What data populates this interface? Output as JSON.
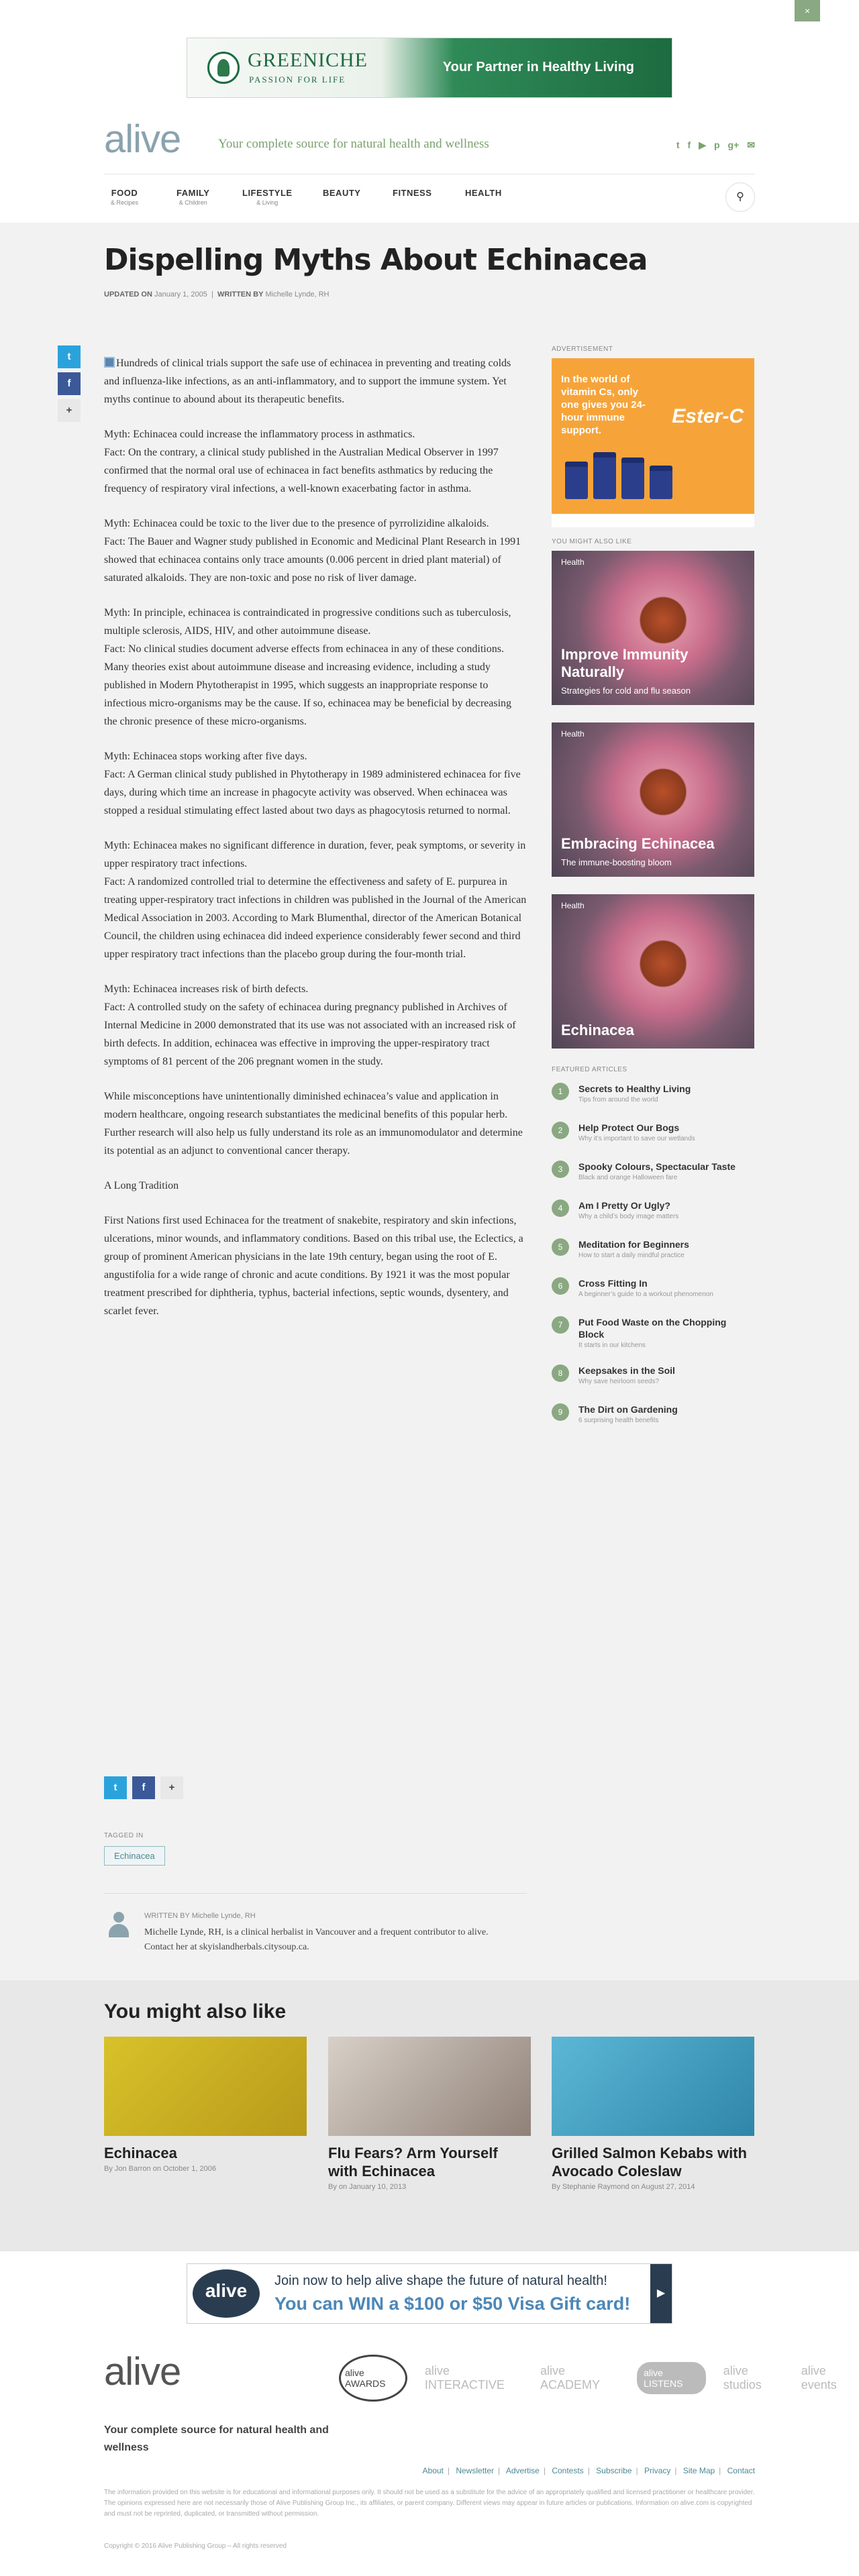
{
  "top": {
    "close_label": "×"
  },
  "banner": {
    "brand": "GREENICHE",
    "tagline": "PASSION FOR LIFE",
    "right_text": "Your Partner in Healthy Living"
  },
  "header": {
    "logo": "alive",
    "tagline": "Your complete source for natural health and wellness",
    "socials": [
      "t",
      "f",
      "▶",
      "p",
      "g+",
      "✉"
    ]
  },
  "nav": [
    {
      "label": "FOOD",
      "sub": "& Recipes"
    },
    {
      "label": "FAMILY",
      "sub": "& Children"
    },
    {
      "label": "LIFESTYLE",
      "sub": "& Living"
    },
    {
      "label": "BEAUTY",
      "sub": ""
    },
    {
      "label": "FITNESS",
      "sub": ""
    },
    {
      "label": "HEALTH",
      "sub": ""
    }
  ],
  "article": {
    "title": "Dispelling Myths About Echinacea",
    "updated_label": "UPDATED ON",
    "updated_date": "January 1, 2005",
    "written_label": "WRITTEN BY",
    "author": "Michelle Lynde, RH",
    "paragraphs": [
      "Hundreds of clinical trials support the safe use of echinacea in preventing and treating colds and influenza-like infections, as an anti-inflammatory, and to support the immune system. Yet myths continue to abound about its therapeutic benefits.",
      "Myth: Echinacea could increase the inflammatory process in asthmatics.\nFact: On the contrary, a clinical study published in the Australian Medical Observer in 1997 confirmed that the normal oral use of echinacea in fact benefits asthmatics by reducing the frequency of respiratory viral infections, a well-known exacerbating factor in asthma.",
      "Myth: Echinacea could be toxic to the liver due to the presence of pyrrolizidine alkaloids.\nFact: The Bauer and Wagner study published in Economic and Medicinal Plant Research in 1991 showed that echinacea contains only trace amounts (0.006 percent in dried plant material) of saturated alkaloids. They are non-toxic and pose no risk of liver damage.",
      "Myth: In principle, echinacea is contraindicated in progressive conditions such as tuberculosis, multiple sclerosis, AIDS, HIV, and other autoimmune disease.\nFact: No clinical studies document adverse effects from echinacea in any of these conditions. Many theories exist about autoimmune disease and increasing evidence, including a study published in Modern Phytotherapist in 1995, which suggests an inappropriate response to infectious micro-organisms may be the cause. If so, echinacea may be beneficial by decreasing the chronic presence of these micro-organisms.",
      "Myth: Echinacea stops working after five days.\nFact: A German clinical study published in Phytotherapy in 1989 administered echinacea for five days, during which time an increase in phagocyte activity was observed. When echinacea was stopped a residual stimulating effect lasted about two days as phagocytosis returned to normal.",
      "Myth: Echinacea makes no significant difference in duration, fever, peak symptoms, or severity in upper respiratory tract infections.\nFact: A randomized controlled trial to determine the effectiveness and safety of E. purpurea in treating upper-respiratory tract infections in children was published in the Journal of the American Medical Association in 2003. According to Mark Blumenthal, director of the American Botanical Council, the children using echinacea did indeed experience considerably fewer second and third upper respiratory tract infections than the placebo group during the four-month trial.",
      "Myth: Echinacea increases risk of birth defects.\nFact: A controlled study on the safety of echinacea during pregnancy published in Archives of Internal Medicine in 2000 demonstrated that its use was not associated with an increased risk of birth defects. In addition, echinacea was effective in improving the upper-respiratory tract symptoms of 81 percent of the 206 pregnant women in the study.",
      "While misconceptions have unintentionally diminished echinacea’s value and application in modern healthcare, ongoing research substantiates the medicinal benefits of this popular herb. Further research will also help us fully understand its role as an immunomodulator and determine its potential as an adjunct to conventional cancer therapy.",
      "A Long Tradition",
      "First Nations first used Echinacea for the treatment of snakebite, respiratory and skin infections, ulcerations, minor wounds, and inflammatory conditions. Based on this tribal use, the Eclectics, a group of prominent American physicians in the late 19th century, began using the root of E. angustifolia for a wide range of chronic and acute conditions. By 1921 it was the most popular treatment prescribed for diphtheria, typhus, bacterial infections, septic wounds, dysentery, and scarlet fever."
    ],
    "tagged_label": "TAGGED IN",
    "tag": "Echinacea",
    "author_box_label": "WRITTEN BY",
    "author_bio": "Michelle Lynde, RH, is a clinical herbalist in Vancouver and a frequent contributor to alive. Contact her at skyislandherbals.citysoup.ca."
  },
  "share": {
    "twitter": "t",
    "facebook": "f",
    "more": "+"
  },
  "sidebar": {
    "ad_label": "ADVERTISEMENT",
    "ad_text": "In the world of vitamin Cs, only one gives you 24-hour immune support.",
    "ad_brand": "Ester-C",
    "might_label": "YOU MIGHT ALSO LIKE",
    "cards": [
      {
        "category": "Health",
        "title": "Improve Immunity Naturally",
        "sub": "Strategies for cold and flu season"
      },
      {
        "category": "Health",
        "title": "Embracing Echinacea",
        "sub": "The immune-boosting bloom"
      },
      {
        "category": "Health",
        "title": "Echinacea",
        "sub": ""
      }
    ],
    "featured_label": "FEATURED ARTICLES",
    "featured": [
      {
        "n": "1",
        "title": "Secrets to Healthy Living",
        "sub": "Tips from around the world"
      },
      {
        "n": "2",
        "title": "Help Protect Our Bogs",
        "sub": "Why it’s important to save our wetlands"
      },
      {
        "n": "3",
        "title": "Spooky Colours, Spectacular Taste",
        "sub": "Black and orange Halloween fare"
      },
      {
        "n": "4",
        "title": "Am I Pretty Or Ugly?",
        "sub": "Why a child’s body image matters"
      },
      {
        "n": "5",
        "title": "Meditation for Beginners",
        "sub": "How to start a daily mindful practice"
      },
      {
        "n": "6",
        "title": "Cross Fitting In",
        "sub": "A beginner’s guide to a workout phenomenon"
      },
      {
        "n": "7",
        "title": "Put Food Waste on the Chopping Block",
        "sub": "It starts in our kitchens"
      },
      {
        "n": "8",
        "title": "Keepsakes in the Soil",
        "sub": "Why save heirloom seeds?"
      },
      {
        "n": "9",
        "title": "The Dirt on Gardening",
        "sub": "6 surprising health benefits"
      }
    ]
  },
  "more": {
    "heading": "You might also like",
    "cards": [
      {
        "title": "Echinacea",
        "by": "By Jon Barron on October 1, 2006",
        "color": "#c8b423"
      },
      {
        "title": "Flu Fears? Arm Yourself with Echinacea",
        "by": "By on January 10, 2013",
        "color": "#b9aea4"
      },
      {
        "title": "Grilled Salmon Kebabs with Avocado Coleslaw",
        "by": "By Stephanie Raymond on August 27, 2014",
        "color": "#4aa3c4"
      }
    ]
  },
  "bottom_banner": {
    "bubble": "alive",
    "line1": "Join now to help alive shape the future of natural health!",
    "line2": "You can WIN a $100 or $50 Visa Gift card!",
    "arrow": "▶"
  },
  "footer": {
    "logo": "alive",
    "brands": [
      "alive AWARDS",
      "alive INTERACTIVE",
      "alive ACADEMY",
      "alive LISTENS",
      "alive studios",
      "alive events"
    ],
    "tagline": "Your complete source for natural health and wellness",
    "links": [
      "About",
      "Newsletter",
      "Advertise",
      "Contests",
      "Subscribe",
      "Privacy",
      "Site Map",
      "Contact"
    ],
    "disclaimer": "The information provided on this website is for educational and informational purposes only. It should not be used as a substitute for the advice of an appropriately qualified and licensed practitioner or healthcare provider. The opinions expressed here are not necessarily those of Alive Publishing Group Inc., its affiliates, or parent company. Different views may appear in future articles or publications. Information on alive.com is copyrighted and must not be reprinted, duplicated, or transmitted without permission.",
    "copyright": "Copyright © 2016 Alive Publishing Group – All rights reserved"
  }
}
